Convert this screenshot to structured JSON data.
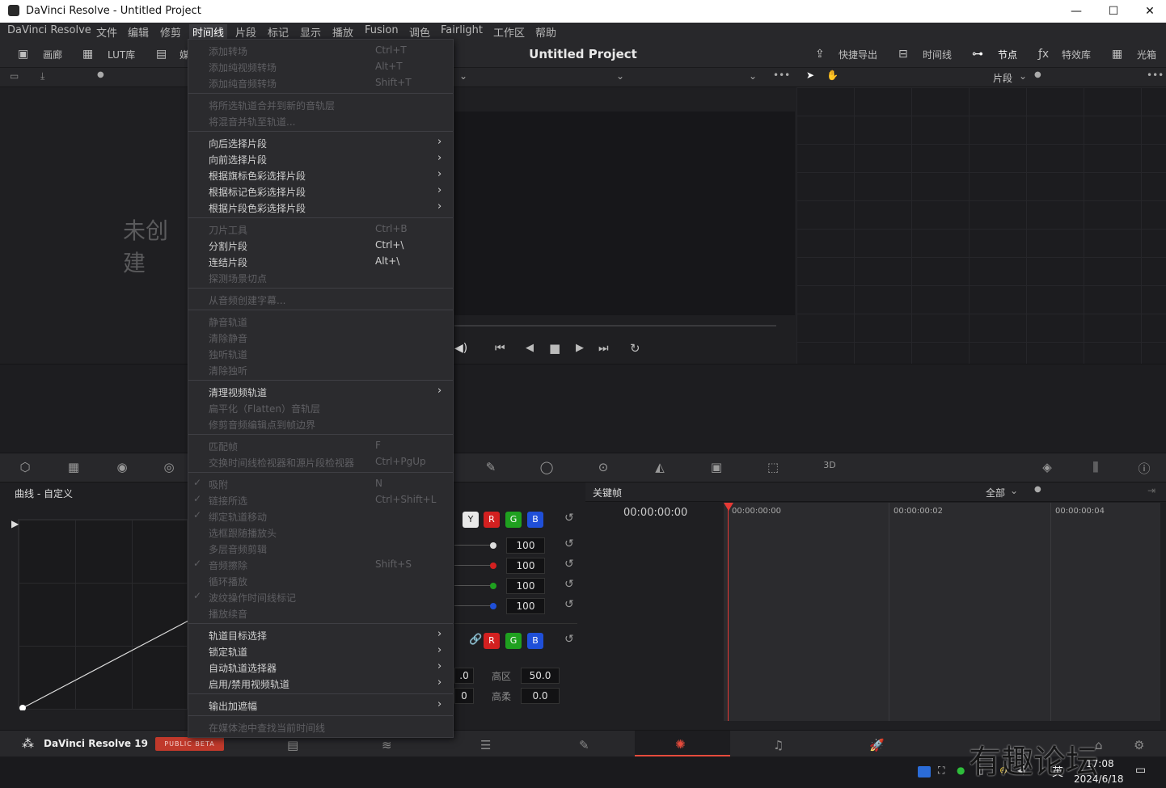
{
  "window": {
    "title": "DaVinci Resolve - Untitled Project",
    "minimize": "—",
    "maximize": "☐",
    "close": "✕"
  },
  "menubar": [
    "DaVinci Resolve",
    "文件",
    "编辑",
    "修剪",
    "时间线",
    "片段",
    "标记",
    "显示",
    "播放",
    "Fusion",
    "调色",
    "Fairlight",
    "工作区",
    "帮助"
  ],
  "toolbar": {
    "gallery": "画廊",
    "lut": "LUT库",
    "media": "媒",
    "project_title": "Untitled Project",
    "quick_export": "快捷导出",
    "timeline": "时间线",
    "nodes": "节点",
    "effects": "特效库",
    "lightbox": "光箱",
    "clip_mode": "片段"
  },
  "gallery_empty": "未创建",
  "timeline_menu": [
    {
      "label": "添加转场",
      "shortcut": "Ctrl+T",
      "enabled": false
    },
    {
      "label": "添加纯视频转场",
      "shortcut": "Alt+T",
      "enabled": false
    },
    {
      "label": "添加纯音频转场",
      "shortcut": "Shift+T",
      "enabled": false
    },
    {
      "sep": true
    },
    {
      "label": "将所选轨道合并到新的音轨层",
      "enabled": false
    },
    {
      "label": "将混音并轨至轨道...",
      "enabled": false
    },
    {
      "sep": true
    },
    {
      "label": "向后选择片段",
      "submenu": true,
      "enabled": true
    },
    {
      "label": "向前选择片段",
      "submenu": true,
      "enabled": true
    },
    {
      "label": "根据旗标色彩选择片段",
      "submenu": true,
      "enabled": true
    },
    {
      "label": "根据标记色彩选择片段",
      "submenu": true,
      "enabled": true
    },
    {
      "label": "根据片段色彩选择片段",
      "submenu": true,
      "enabled": true
    },
    {
      "sep": true
    },
    {
      "label": "刀片工具",
      "shortcut": "Ctrl+B",
      "enabled": false
    },
    {
      "label": "分割片段",
      "shortcut": "Ctrl+\\",
      "enabled": true
    },
    {
      "label": "连结片段",
      "shortcut": "Alt+\\",
      "enabled": true
    },
    {
      "label": "探测场景切点",
      "enabled": false
    },
    {
      "sep": true
    },
    {
      "label": "从音频创建字幕...",
      "enabled": false
    },
    {
      "sep": true
    },
    {
      "label": "静音轨道",
      "enabled": false
    },
    {
      "label": "清除静音",
      "enabled": false
    },
    {
      "label": "独听轨道",
      "enabled": false
    },
    {
      "label": "清除独听",
      "enabled": false
    },
    {
      "sep": true
    },
    {
      "label": "清理视频轨道",
      "submenu": true,
      "enabled": true
    },
    {
      "label": "扁平化（Flatten）音轨层",
      "enabled": false
    },
    {
      "label": "修剪音频编辑点到帧边界",
      "enabled": false
    },
    {
      "sep": true
    },
    {
      "label": "匹配帧",
      "shortcut": "F",
      "enabled": false
    },
    {
      "label": "交换时间线检视器和源片段检视器",
      "shortcut": "Ctrl+PgUp",
      "enabled": false
    },
    {
      "sep": true
    },
    {
      "label": "吸附",
      "shortcut": "N",
      "enabled": false,
      "checked": true
    },
    {
      "label": "链接所选",
      "shortcut": "Ctrl+Shift+L",
      "enabled": false,
      "checked": true
    },
    {
      "label": "绑定轨道移动",
      "enabled": false,
      "checked": true
    },
    {
      "label": "选框跟随播放头",
      "enabled": false
    },
    {
      "label": "多层音频剪辑",
      "enabled": false
    },
    {
      "label": "音频擦除",
      "shortcut": "Shift+S",
      "enabled": false,
      "checked": true
    },
    {
      "label": "循环播放",
      "enabled": false
    },
    {
      "label": "波纹操作时间线标记",
      "enabled": false,
      "checked": true
    },
    {
      "label": "播放续音",
      "enabled": false
    },
    {
      "sep": true
    },
    {
      "label": "轨道目标选择",
      "submenu": true,
      "enabled": true
    },
    {
      "label": "锁定轨道",
      "submenu": true,
      "enabled": true
    },
    {
      "label": "自动轨道选择器",
      "submenu": true,
      "enabled": true
    },
    {
      "label": "启用/禁用视频轨道",
      "submenu": true,
      "enabled": true
    },
    {
      "sep": true
    },
    {
      "label": "输出加遮幅",
      "submenu": true,
      "enabled": true
    },
    {
      "sep": true
    },
    {
      "label": "在媒体池中查找当前时间线",
      "enabled": false
    }
  ],
  "curves": {
    "title": "曲线 - 自定义"
  },
  "primaries": {
    "channels": [
      "Y",
      "R",
      "G",
      "B"
    ],
    "values": [
      "100",
      "100",
      "100",
      "100"
    ],
    "links": [
      "R",
      "G",
      "B"
    ],
    "left_vals": [
      ".0",
      "0"
    ],
    "highlight_label": "高区",
    "highlight_value": "50.0",
    "soft_label": "高柔",
    "soft_value": "0.0"
  },
  "keyframes": {
    "title": "关键帧",
    "filter": "全部",
    "timecode": "00:00:00:00",
    "ruler": [
      "00:00:00:00",
      "00:00:00:02",
      "00:00:00:04"
    ]
  },
  "pagebar": {
    "app": "DaVinci Resolve 19",
    "badge": "PUBLIC BETA"
  },
  "taskbar": {
    "ime": "英",
    "time": "17:08",
    "date": "2024/6/18",
    "watermark": "有趣论坛"
  },
  "colors": {
    "accent": "#e64b3c",
    "playhead": "#e53935",
    "badge": "#c0392b"
  }
}
